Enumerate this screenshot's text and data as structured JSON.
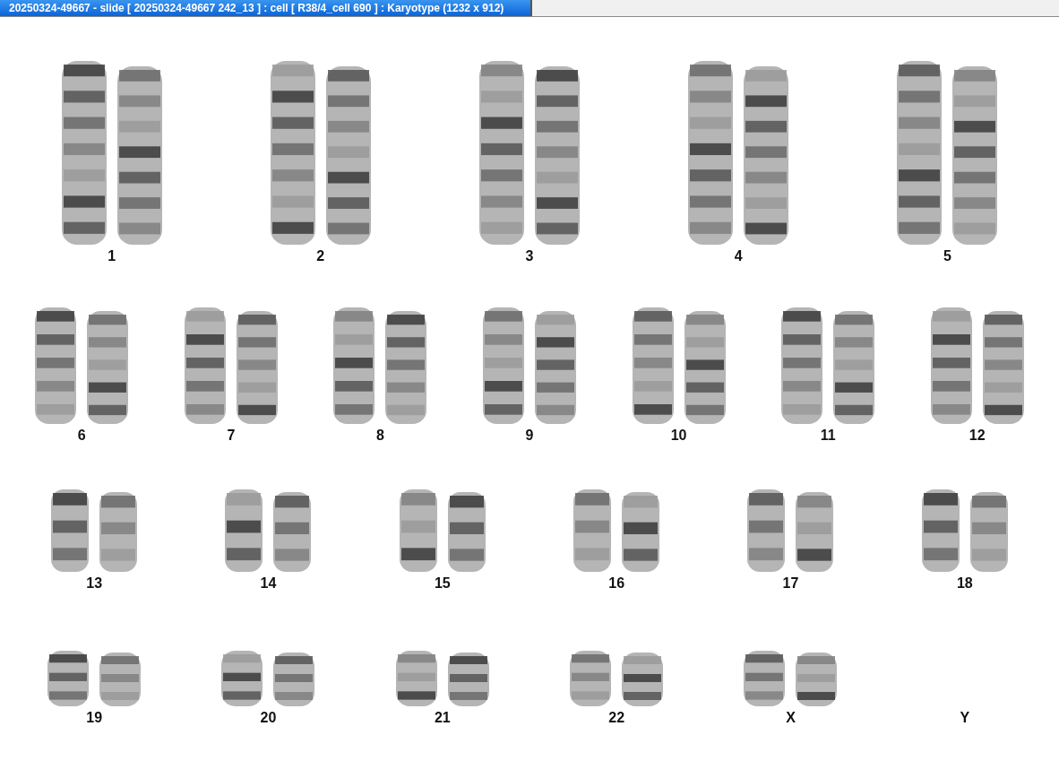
{
  "window": {
    "title": "20250324-49667 - slide [ 20250324-49667 242_13 ] : cell [ R38/4_cell 690 ] : Karyotype  (1232 x 912)"
  },
  "karyotype": {
    "rows": [
      [
        {
          "label": "1",
          "kind": "pair"
        },
        {
          "label": "2",
          "kind": "pair"
        },
        {
          "label": "3",
          "kind": "pair"
        },
        {
          "label": "4",
          "kind": "pair"
        },
        {
          "label": "5",
          "kind": "pair"
        }
      ],
      [
        {
          "label": "6",
          "kind": "pair"
        },
        {
          "label": "7",
          "kind": "pair"
        },
        {
          "label": "8",
          "kind": "pair"
        },
        {
          "label": "9",
          "kind": "pair"
        },
        {
          "label": "10",
          "kind": "pair"
        },
        {
          "label": "11",
          "kind": "pair"
        },
        {
          "label": "12",
          "kind": "pair"
        }
      ],
      [
        {
          "label": "13",
          "kind": "pair"
        },
        {
          "label": "14",
          "kind": "pair"
        },
        {
          "label": "15",
          "kind": "pair"
        },
        {
          "label": "16",
          "kind": "pair"
        },
        {
          "label": "17",
          "kind": "pair"
        },
        {
          "label": "18",
          "kind": "pair"
        }
      ],
      [
        {
          "label": "19",
          "kind": "pair"
        },
        {
          "label": "20",
          "kind": "pair"
        },
        {
          "label": "21",
          "kind": "pair"
        },
        {
          "label": "22",
          "kind": "pair"
        },
        {
          "label": "X",
          "kind": "pair"
        },
        {
          "label": "Y",
          "kind": "empty"
        }
      ]
    ]
  }
}
